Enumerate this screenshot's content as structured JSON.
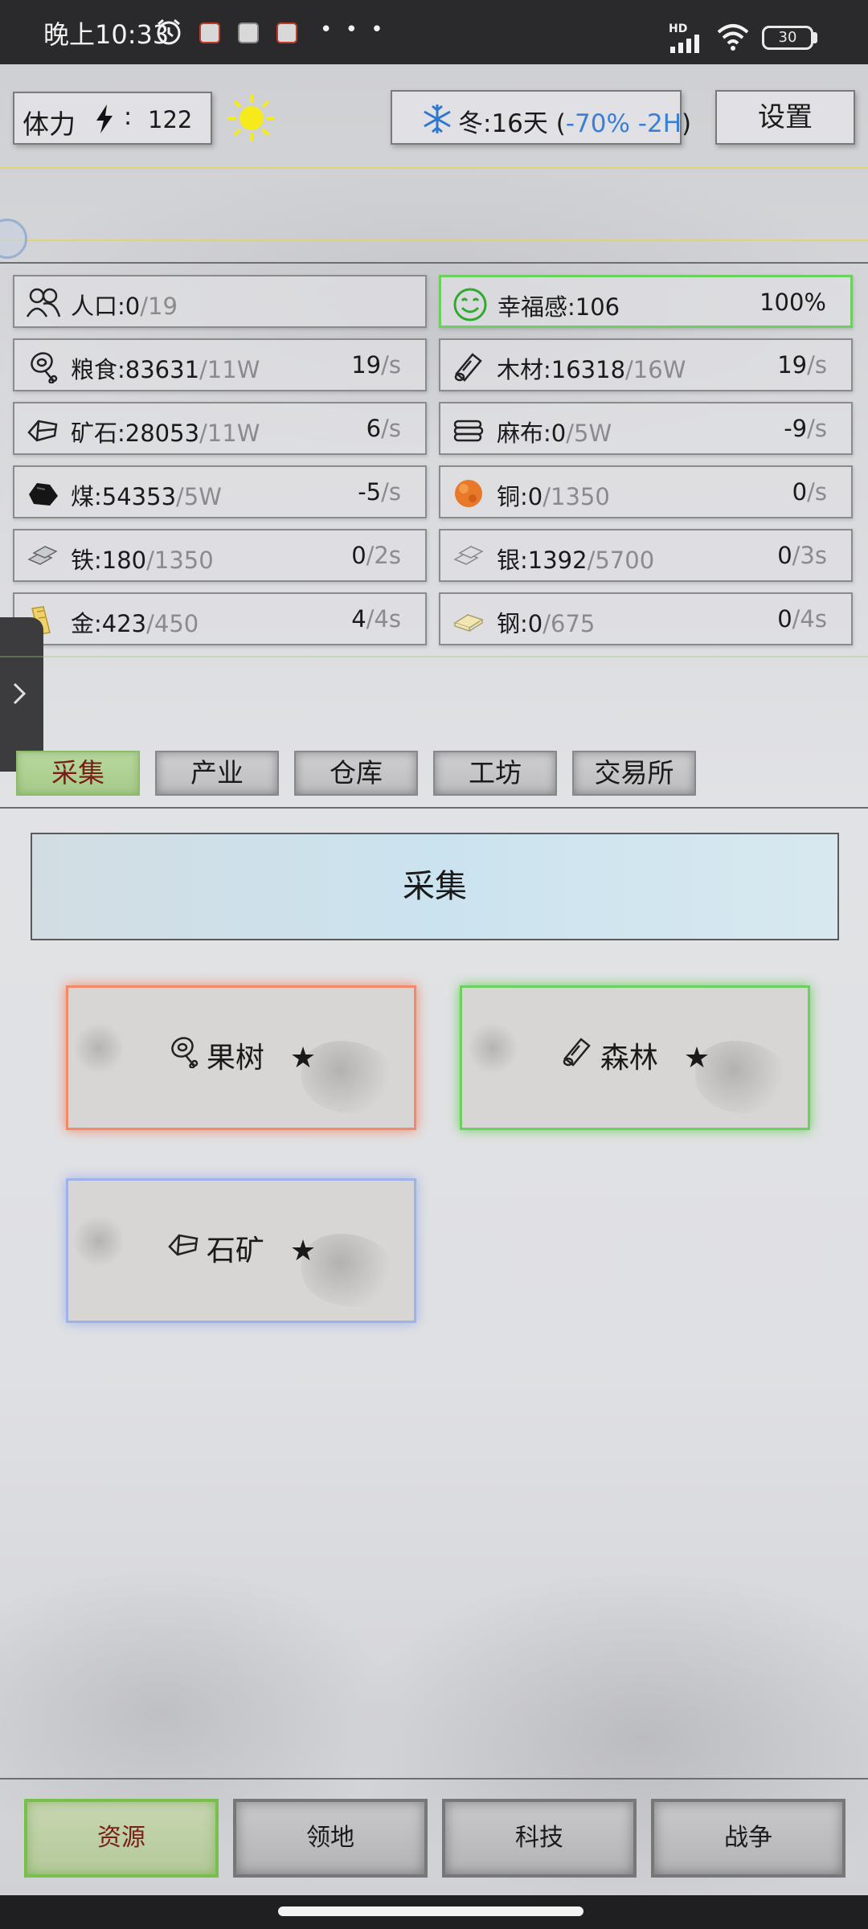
{
  "status_bar": {
    "time": "晚上10:33",
    "network_label": "HD",
    "battery": "30",
    "more": "• • •"
  },
  "top_bar": {
    "stamina_label": "体力",
    "stamina_sep": ":",
    "stamina_value": "122",
    "season_label": "冬:16天",
    "season_open": "(",
    "season_modifier": "-70% -2H",
    "season_close": ")",
    "settings_label": "设置"
  },
  "population": {
    "label": "人口:0",
    "cap": "/19"
  },
  "happiness": {
    "label": "幸福感:106",
    "percent": "100%"
  },
  "resources": [
    {
      "label": "粮食:83631",
      "cap": "/11W",
      "rate": "19",
      "unit": "/s",
      "icon": "meat-icon"
    },
    {
      "label": "木材:16318",
      "cap": "/16W",
      "rate": "19",
      "unit": "/s",
      "icon": "log-icon"
    },
    {
      "label": "矿石:28053",
      "cap": "/11W",
      "rate": "6",
      "unit": "/s",
      "icon": "stone-icon"
    },
    {
      "label": "麻布:0",
      "cap": "/5W",
      "rate": "-9",
      "unit": "/s",
      "icon": "cloth-icon"
    },
    {
      "label": "煤:54353",
      "cap": "/5W",
      "rate": "-5",
      "unit": "/s",
      "icon": "coal-icon"
    },
    {
      "label": "铜:0",
      "cap": "/1350",
      "rate": "0",
      "unit": "/s",
      "icon": "copper-icon"
    },
    {
      "label": "铁:180",
      "cap": "/1350",
      "rate": "0",
      "unit": "/2s",
      "icon": "iron-icon"
    },
    {
      "label": "银:1392",
      "cap": "/5700",
      "rate": "0",
      "unit": "/3s",
      "icon": "silver-icon"
    },
    {
      "label": "金:423",
      "cap": "/450",
      "rate": "4",
      "unit": "/4s",
      "icon": "gold-icon"
    },
    {
      "label": "钢:0",
      "cap": "/675",
      "rate": "0",
      "unit": "/4s",
      "icon": "steel-icon"
    }
  ],
  "tabs": [
    "采集",
    "产业",
    "仓库",
    "工坊",
    "交易所"
  ],
  "section_title": "采集",
  "gather_cards": [
    {
      "label": "果树",
      "star": "★",
      "icon": "meat-icon",
      "border": "#f08a68"
    },
    {
      "label": "森林",
      "star": "★",
      "icon": "log-icon",
      "border": "#6dcf5f"
    },
    {
      "label": "石矿",
      "star": "★",
      "icon": "stone-icon",
      "border": "#9fb3e8"
    }
  ],
  "bottom_nav": [
    "资源",
    "领地",
    "科技",
    "战争"
  ],
  "colors": {
    "accent_green": "#6dcf5f",
    "season_blue": "#3a7fd6",
    "sun_yellow": "#f4ea1c"
  }
}
